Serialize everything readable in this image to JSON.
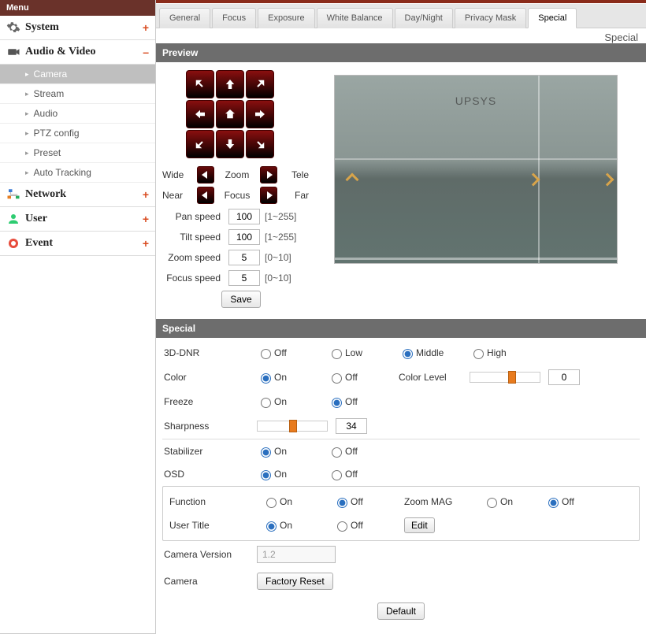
{
  "menu": {
    "title": "Menu",
    "categories": [
      {
        "label": "System",
        "toggle": "+"
      },
      {
        "label": "Audio & Video",
        "toggle": "–"
      },
      {
        "label": "Network",
        "toggle": "+"
      },
      {
        "label": "User",
        "toggle": "+"
      },
      {
        "label": "Event",
        "toggle": "+"
      }
    ],
    "audio_video_items": [
      {
        "label": "Camera",
        "active": true
      },
      {
        "label": "Stream"
      },
      {
        "label": "Audio"
      },
      {
        "label": "PTZ config"
      },
      {
        "label": "Preset"
      },
      {
        "label": "Auto Tracking"
      }
    ]
  },
  "tabs": {
    "items": [
      "General",
      "Focus",
      "Exposure",
      "White Balance",
      "Day/Night",
      "Privacy Mask",
      "Special"
    ],
    "active": "Special",
    "subtitle": "Special"
  },
  "preview": {
    "header": "Preview",
    "watermark": "UPSYS",
    "zoom": {
      "wide": "Wide",
      "label": "Zoom",
      "tele": "Tele"
    },
    "focus": {
      "near": "Near",
      "label": "Focus",
      "far": "Far"
    },
    "speeds": [
      {
        "label": "Pan speed",
        "value": "100",
        "range": "[1~255]"
      },
      {
        "label": "Tilt speed",
        "value": "100",
        "range": "[1~255]"
      },
      {
        "label": "Zoom speed",
        "value": "5",
        "range": "[0~10]"
      },
      {
        "label": "Focus speed",
        "value": "5",
        "range": "[0~10]"
      }
    ],
    "save": "Save"
  },
  "special": {
    "header": "Special",
    "rows": {
      "dnr": {
        "label": "3D-DNR",
        "options": [
          "Off",
          "Low",
          "Middle",
          "High"
        ],
        "value": "Middle"
      },
      "color": {
        "label": "Color",
        "options": [
          "On",
          "Off"
        ],
        "value": "On",
        "level_label": "Color Level",
        "level_value": "0",
        "slider_pct": 54
      },
      "freeze": {
        "label": "Freeze",
        "options": [
          "On",
          "Off"
        ],
        "value": "Off"
      },
      "sharpness": {
        "label": "Sharpness",
        "value": "34",
        "slider_pct": 46
      },
      "stabilizer": {
        "label": "Stabilizer",
        "options": [
          "On",
          "Off"
        ],
        "value": "On"
      },
      "osd": {
        "label": "OSD",
        "options": [
          "On",
          "Off"
        ],
        "value": "On"
      },
      "function": {
        "label": "Function",
        "options": [
          "On",
          "Off"
        ],
        "value": "Off",
        "zoom_label": "Zoom MAG",
        "zoom_options": [
          "On",
          "Off"
        ],
        "zoom_value": "Off"
      },
      "usertitle": {
        "label": "User Title",
        "options": [
          "On",
          "Off"
        ],
        "value": "On",
        "edit": "Edit"
      },
      "camver": {
        "label": "Camera Version",
        "value": "1.2"
      },
      "camera": {
        "label": "Camera",
        "reset": "Factory Reset"
      }
    },
    "default_btn": "Default"
  }
}
